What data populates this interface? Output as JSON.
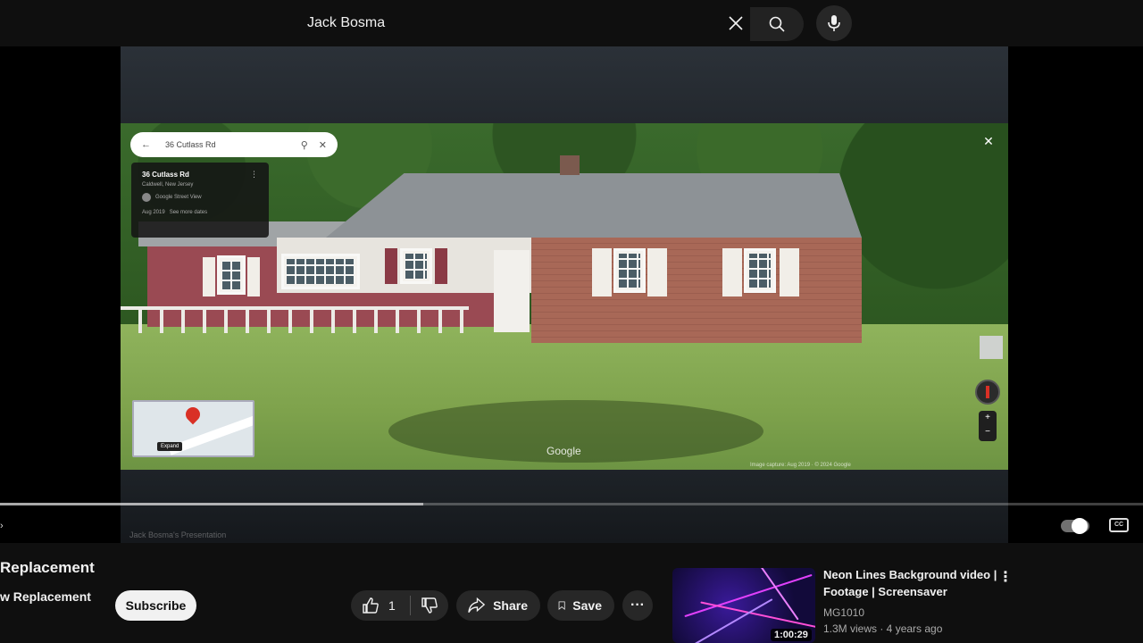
{
  "search": {
    "query": "Jack Bosma"
  },
  "streetview": {
    "search_text": "36 Cutlass Rd",
    "place_title": "36 Cutlass Rd",
    "place_region": "Caldwell, New Jersey",
    "source": "Google Street View",
    "capture_date": "Aug 2019",
    "see_more": "See more dates",
    "minimap_chip": "Expand",
    "brand": "Google",
    "attribution": "Image capture: Aug 2019 · © 2024 Google"
  },
  "player": {
    "progress_fraction": 0.37,
    "watermark": "Jack Bosma's Presentation"
  },
  "video": {
    "title": "Replacement",
    "channel": "w Replacement",
    "subscribe_label": "Subscribe",
    "like_count": "1",
    "share_label": "Share",
    "save_label": "Save",
    "more_label": "···"
  },
  "recommended": {
    "title": "Neon Lines Background video | Footage | Screensaver",
    "channel": "MG1010",
    "meta": "1.3M views · 4 years ago",
    "duration": "1:00:29"
  }
}
